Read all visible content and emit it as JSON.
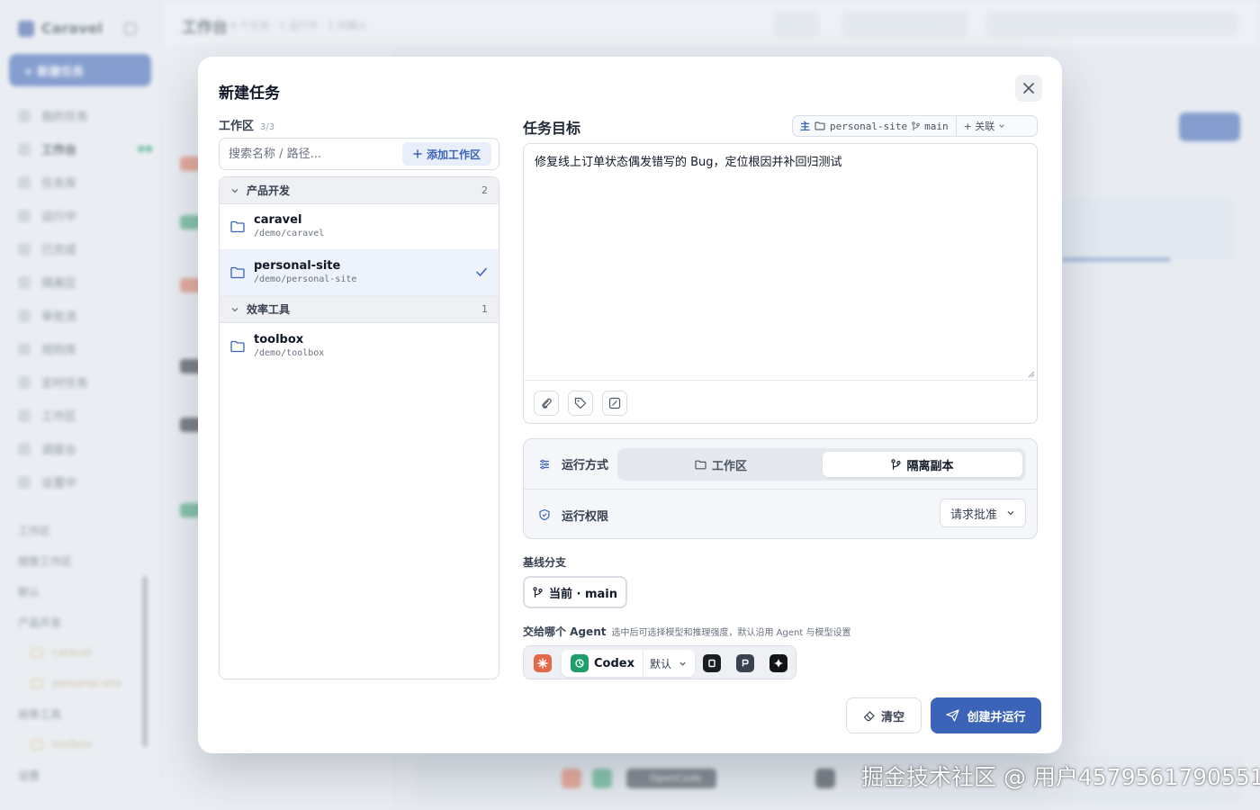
{
  "background": {
    "app_name": "Caravel",
    "new_task_label": "+ 新建任务",
    "page_title": "工作台",
    "page_subtitle": "6 个任务 · 1 运行中 · 1 待确认",
    "nav_items": [
      "我的任务",
      "工作台",
      "任务库",
      "运行中",
      "已完成",
      "隔离区",
      "审批流",
      "规则库",
      "定时任务",
      "工作区",
      "调度台",
      "设置中"
    ],
    "workspace_tree": [
      "工作区",
      "搜索工作区",
      "默认",
      "产品开发",
      "caravel",
      "personal-site",
      "效率工具",
      "toolbox",
      "设置"
    ],
    "bottom_bar_agent": "OpenCode"
  },
  "modal": {
    "title": "新建任务",
    "close_icon": "close-icon",
    "workspace": {
      "label": "工作区",
      "count": "3/3",
      "search_placeholder": "搜索名称 / 路径...",
      "add_label": "添加工作区",
      "groups": [
        {
          "name": "产品开发",
          "count": "2",
          "items": [
            {
              "name": "caravel",
              "path": "/demo/caravel",
              "selected": false
            },
            {
              "name": "personal-site",
              "path": "/demo/personal-site",
              "selected": true
            }
          ]
        },
        {
          "name": "效率工具",
          "count": "1",
          "items": [
            {
              "name": "toolbox",
              "path": "/demo/toolbox",
              "selected": false
            }
          ]
        }
      ]
    },
    "goal": {
      "label": "任务目标",
      "repo_tag": "主",
      "repo_name": "personal-site",
      "repo_branch": "main",
      "link_label": "+ 关联",
      "text": "修复线上订单状态偶发错写的 Bug，定位根因并补回归测试"
    },
    "run_mode": {
      "label": "运行方式",
      "options": [
        "工作区",
        "隔离副本"
      ],
      "selected": "隔离副本"
    },
    "permission": {
      "label": "运行权限",
      "value": "请求批准"
    },
    "baseline_branch": {
      "label": "基线分支",
      "value": "当前 · main"
    },
    "agent": {
      "label": "交给哪个 Agent",
      "hint": "选中后可选择模型和推理强度，默认沿用 Agent 与模型设置",
      "selected": "Codex",
      "model": "默认",
      "icons": [
        "claude-icon",
        "codex-icon",
        "opencode-icon",
        "pi-icon",
        "gemini-icon"
      ]
    },
    "actions": {
      "clear": "清空",
      "create_run": "创建并运行"
    },
    "accent": "#3b63b7"
  },
  "watermark": "掘金技术社区 @ 用户4579561790551"
}
